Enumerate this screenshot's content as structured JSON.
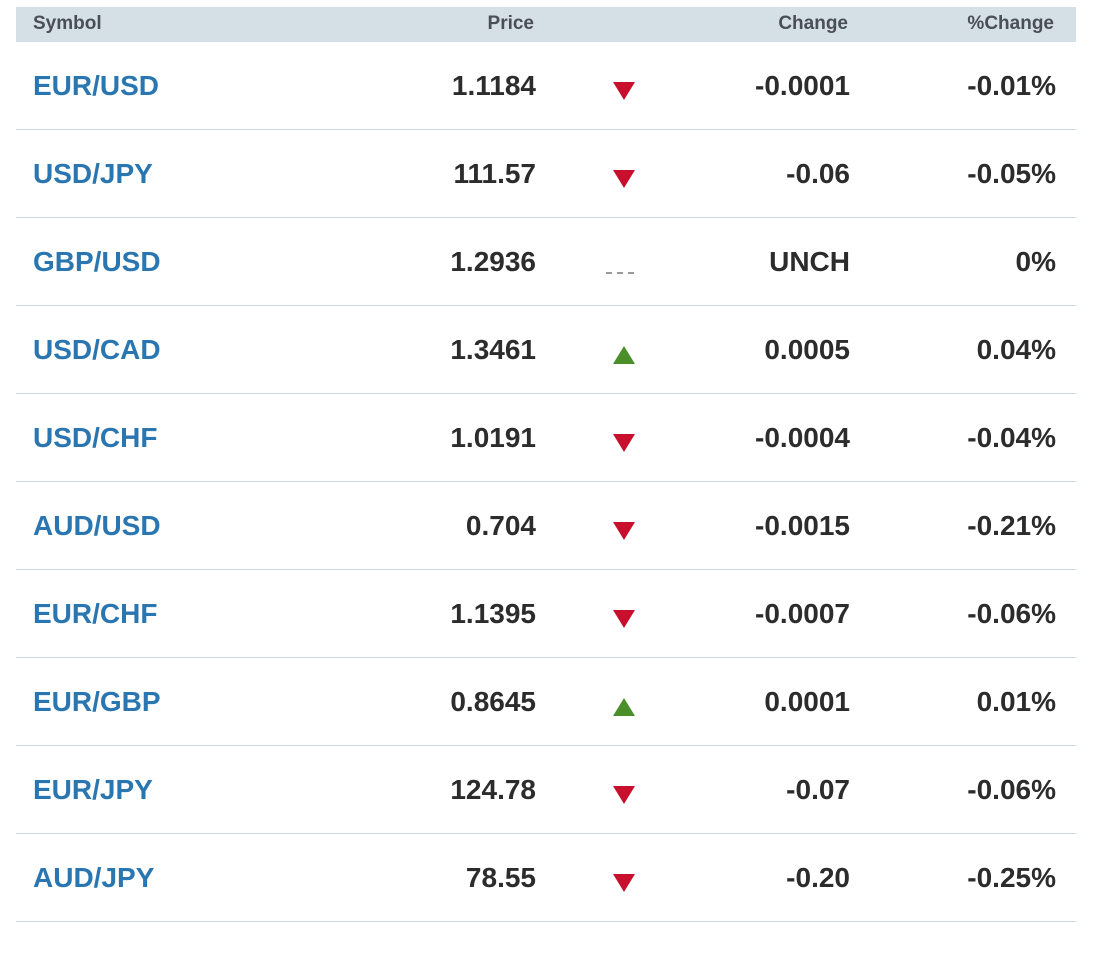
{
  "columns": {
    "symbol": "Symbol",
    "price": "Price",
    "change": "Change",
    "pct_change": "%Change"
  },
  "colors": {
    "header_bg": "#d4dfe6",
    "symbol_link": "#2a76b0",
    "down": "#c8102e",
    "up": "#4a8f2a",
    "flat": "#9a9a9a"
  },
  "rows": [
    {
      "symbol": "EUR/USD",
      "price": "1.1184",
      "direction": "down",
      "change": "-0.0001",
      "pct_change": "-0.01%"
    },
    {
      "symbol": "USD/JPY",
      "price": "111.57",
      "direction": "down",
      "change": "-0.06",
      "pct_change": "-0.05%"
    },
    {
      "symbol": "GBP/USD",
      "price": "1.2936",
      "direction": "flat",
      "change": "UNCH",
      "pct_change": "0%"
    },
    {
      "symbol": "USD/CAD",
      "price": "1.3461",
      "direction": "up",
      "change": "0.0005",
      "pct_change": "0.04%"
    },
    {
      "symbol": "USD/CHF",
      "price": "1.0191",
      "direction": "down",
      "change": "-0.0004",
      "pct_change": "-0.04%"
    },
    {
      "symbol": "AUD/USD",
      "price": "0.704",
      "direction": "down",
      "change": "-0.0015",
      "pct_change": "-0.21%"
    },
    {
      "symbol": "EUR/CHF",
      "price": "1.1395",
      "direction": "down",
      "change": "-0.0007",
      "pct_change": "-0.06%"
    },
    {
      "symbol": "EUR/GBP",
      "price": "0.8645",
      "direction": "up",
      "change": "0.0001",
      "pct_change": "0.01%"
    },
    {
      "symbol": "EUR/JPY",
      "price": "124.78",
      "direction": "down",
      "change": "-0.07",
      "pct_change": "-0.06%"
    },
    {
      "symbol": "AUD/JPY",
      "price": "78.55",
      "direction": "down",
      "change": "-0.20",
      "pct_change": "-0.25%"
    }
  ]
}
